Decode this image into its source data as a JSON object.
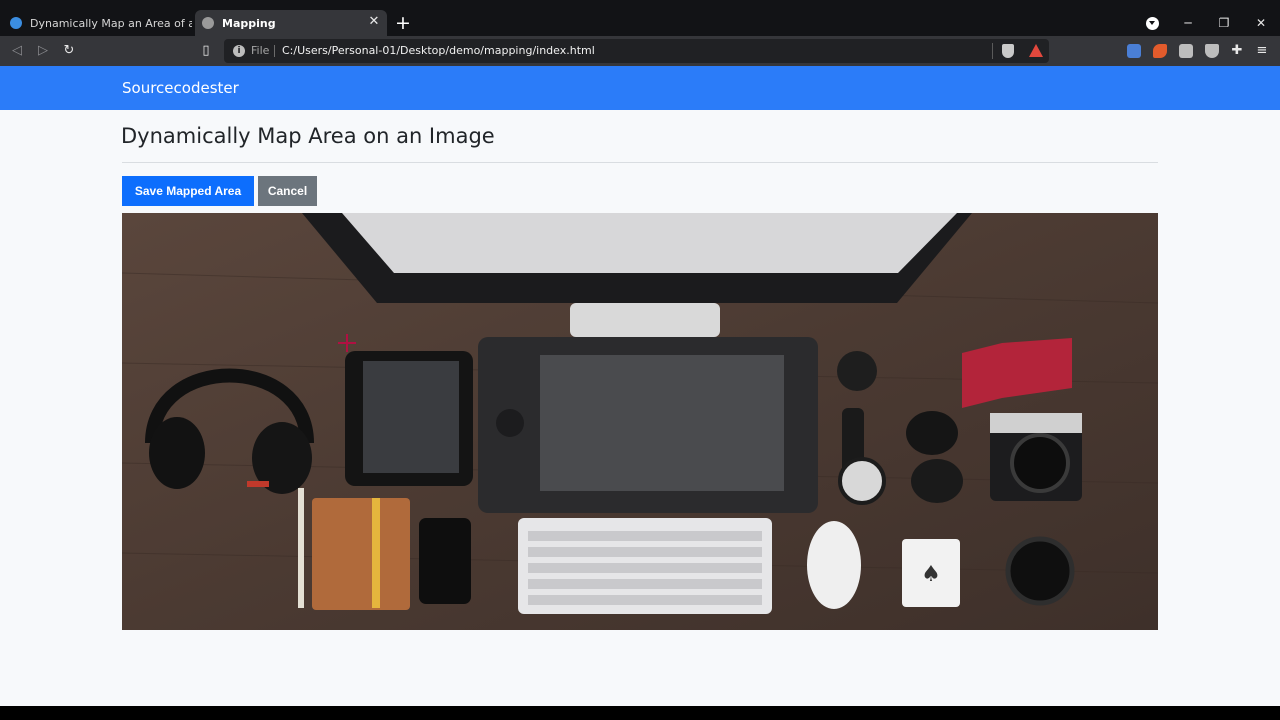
{
  "browser": {
    "tabs": [
      {
        "title": "Dynamically Map an Area of an Image",
        "active": false
      },
      {
        "title": "Mapping",
        "active": true
      }
    ],
    "address": {
      "scheme_label": "File",
      "url": "C:/Users/Personal-01/Desktop/demo/mapping/index.html"
    }
  },
  "navbar": {
    "brand": "Sourcecodester"
  },
  "main": {
    "title": "Dynamically Map Area on an Image",
    "save_label": "Save Mapped Area",
    "cancel_label": "Cancel"
  },
  "colors": {
    "navbar": "#2b7cf9",
    "save_button": "#0d6efd",
    "cancel_button": "#6c757d"
  }
}
